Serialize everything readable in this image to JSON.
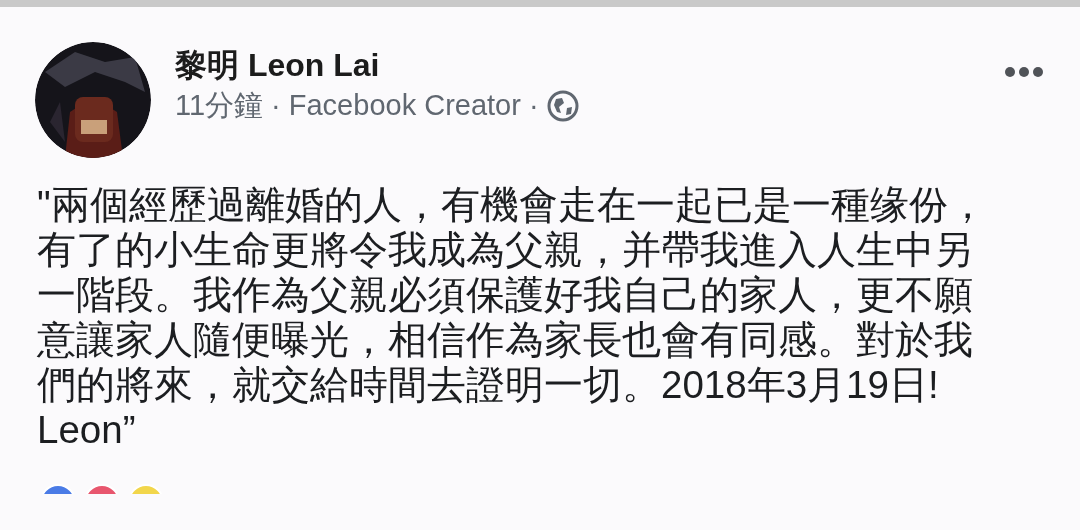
{
  "post": {
    "author": "黎明 Leon Lai",
    "time": "11分鐘",
    "separator_1": "·",
    "app": "Facebook Creator",
    "separator_2": "·",
    "text": "\"兩個經歷過離婚的人，有機會走在一起已是一種缘份，有了的小生命更將令我成為父親，并帶我進入人生中另一階段。我作為父親必須保護好我自己的家人，更不願意讓家人隨便曝光，相信作為家長也會有同感。對於我們的將來，就交給時間去證明一切。2018年3月19日!",
    "signature": "Leon”",
    "reactions": [
      {
        "color": "#4a7be6"
      },
      {
        "color": "#e8566e"
      },
      {
        "color": "#f2d64b"
      }
    ]
  }
}
